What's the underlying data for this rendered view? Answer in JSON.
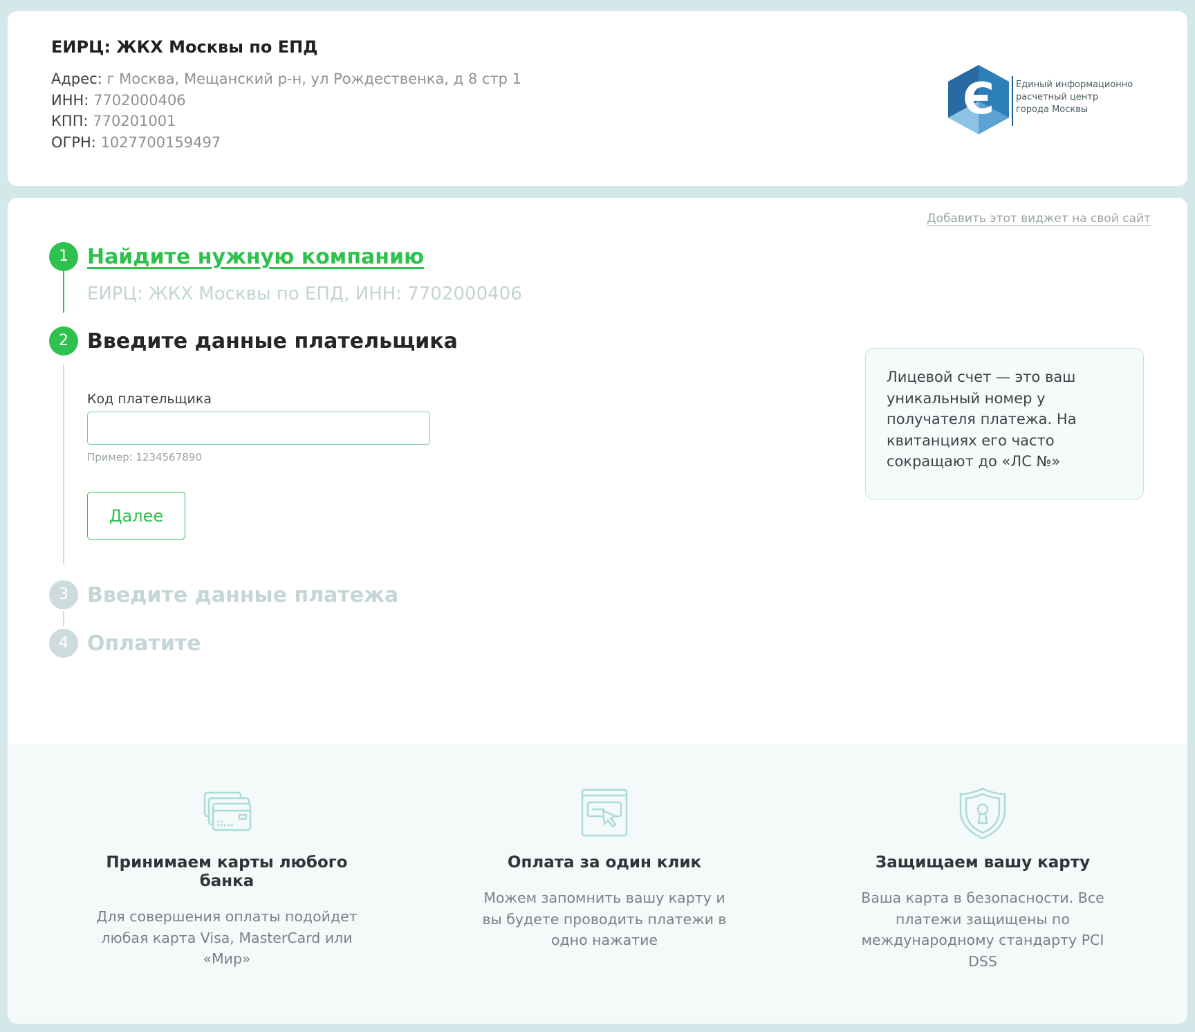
{
  "company": {
    "title": "ЕИРЦ: ЖКХ Москвы по ЕПД",
    "address_label": "Адрес:",
    "address_value": "г Москва, Мещанский р-н, ул Рождественка, д 8 стр 1",
    "inn_label": "ИНН:",
    "inn_value": "7702000406",
    "kpp_label": "КПП:",
    "kpp_value": "770201001",
    "ogrn_label": "ОГРН:",
    "ogrn_value": "1027700159497",
    "logo": {
      "icon": "eirts-hexagon-logo",
      "line1": "Единый информационно",
      "line2": "расчетный центр",
      "line3": "города Москвы"
    }
  },
  "widget_link": "Добавить этот виджет на свой сайт",
  "steps": [
    {
      "number": "1",
      "title": "Найдите нужную компанию",
      "summary": "ЕИРЦ: ЖКХ Москвы по ЕПД, ИНН: 7702000406",
      "state": "done"
    },
    {
      "number": "2",
      "title": "Введите данные плательщика",
      "state": "active"
    },
    {
      "number": "3",
      "title": "Введите данные платежа",
      "state": "disabled"
    },
    {
      "number": "4",
      "title": "Оплатите",
      "state": "disabled"
    }
  ],
  "payer_form": {
    "label": "Код плательщика",
    "value": "",
    "placeholder": "",
    "hint": "Пример: 1234567890",
    "next_button": "Далее"
  },
  "info_box": "Лицевой счет — это ваш уникальный номер у получателя платежа. На квитанциях его часто сокращают до «ЛС №»",
  "features": [
    {
      "icon": "credit-cards-icon",
      "title": "Принимаем карты любого банка",
      "desc": "Для совершения оплаты подойдет любая карта Visa, MasterCard или «Мир»"
    },
    {
      "icon": "one-click-payment-icon",
      "title": "Оплата за один клик",
      "desc": "Можем запомнить вашу карту и вы будете проводить платежи в одно нажатие"
    },
    {
      "icon": "security-shield-icon",
      "title": "Защищаем вашу карту",
      "desc": "Ваша карта в безопасности. Все платежи защищены по международному стандарту PCI DSS"
    }
  ],
  "colors": {
    "accent": "#2ec14d",
    "page_bg": "#d5e8e9",
    "disabled": "#ccdcdd",
    "info_bg": "#f5fbfb",
    "info_border": "#bce7e5"
  }
}
